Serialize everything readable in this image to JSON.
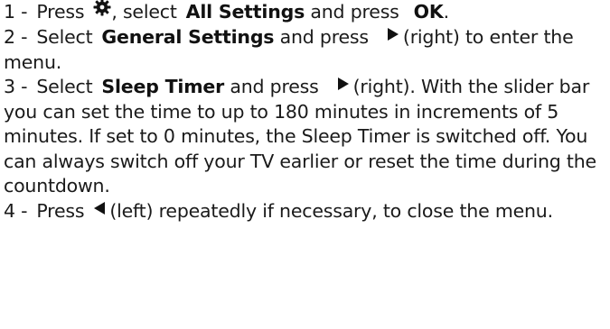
{
  "steps": [
    {
      "number": "1 -",
      "parts": {
        "p1": "Press",
        "p2": ", select",
        "b1": "All Settings",
        "p3": "and press",
        "b2": "OK",
        "p4": "."
      },
      "icon": "gear-icon"
    },
    {
      "number": "2 -",
      "parts": {
        "p1": "Select",
        "b1": "General Settings",
        "p2": "and press",
        "p3": "(right) to enter the menu."
      },
      "icon": "right-arrow-icon"
    },
    {
      "number": "3 -",
      "parts": {
        "p1": "Select",
        "b1": "Sleep Timer",
        "p2": "and press",
        "p3": "(right). With the slider bar you can set the time to up to 180 minutes in increments of 5 minutes. If set to 0 minutes, the Sleep Timer is switched off. You can always switch off your TV earlier or reset the time during the countdown."
      },
      "icon": "right-arrow-icon"
    },
    {
      "number": "4 -",
      "parts": {
        "p1": "Press",
        "p2": "(left) repeatedly if necessary, to close the menu."
      },
      "icon": "left-arrow-icon"
    }
  ],
  "colors": {
    "text": "#1a1a1a",
    "icon": "#111111"
  }
}
